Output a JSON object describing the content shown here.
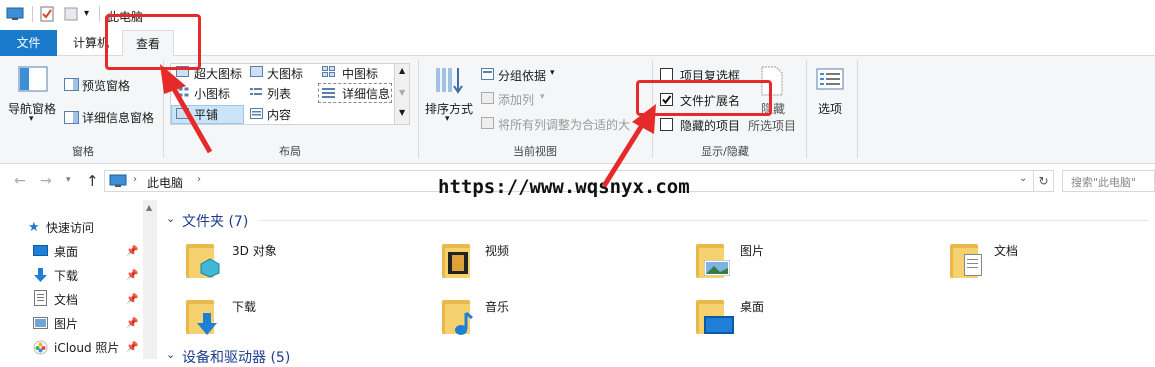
{
  "window": {
    "title": "此电脑"
  },
  "tabs": {
    "file": "文件",
    "computer": "计算机",
    "view": "查看"
  },
  "ribbon": {
    "panes": {
      "nav_pane": "导航窗格",
      "preview": "预览窗格",
      "details": "详细信息窗格",
      "group": "窗格"
    },
    "layout": {
      "items": [
        "超大图标",
        "大图标",
        "中图标",
        "小图标",
        "列表",
        "详细信息",
        "平铺",
        "内容"
      ],
      "group": "布局"
    },
    "current_view": {
      "sort": "排序方式",
      "group_by": "分组依据",
      "add_column": "添加列",
      "fit_columns": "将所有列调整为合适的大",
      "group": "当前视图"
    },
    "show_hide": {
      "item_checkboxes": "项目复选框",
      "file_ext": "文件扩展名",
      "hidden_items": "隐藏的项目",
      "hide": "隐藏",
      "selected": "所选项目",
      "group": "显示/隐藏",
      "checked": {
        "item_checkboxes": false,
        "file_ext": true,
        "hidden_items": false
      }
    },
    "options": "选项"
  },
  "address": {
    "path": "此电脑",
    "search_placeholder": "搜索\"此电脑\""
  },
  "watermark": "https://www.wqsnyx.com",
  "nav": {
    "quick_access": "快速访问",
    "items": [
      "桌面",
      "下载",
      "文档",
      "图片",
      "iCloud 照片"
    ]
  },
  "main": {
    "folders_header": "文件夹 (7)",
    "folders": [
      "3D 对象",
      "视频",
      "图片",
      "文档",
      "下载",
      "音乐",
      "桌面"
    ],
    "devices_header": "设备和驱动器 (5)"
  },
  "colors": {
    "accent": "#1979ca",
    "annotation": "#e62a2a"
  }
}
